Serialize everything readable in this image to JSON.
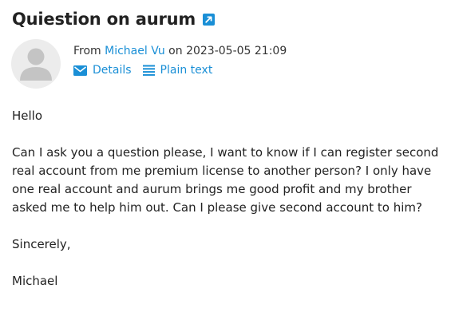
{
  "email": {
    "subject": "Quiestion on aurum",
    "from_prefix": "From",
    "sender_name": "Michael Vu",
    "on_word": "on",
    "timestamp": "2023-05-05 21:09",
    "actions": {
      "details_label": "Details",
      "plain_text_label": "Plain text"
    },
    "body": {
      "greeting": "Hello",
      "paragraph": "Can I ask you a question please, I want to know if I can register second real account from me premium license to another person? I only have one real account and aurum brings me good profit and my brother asked me to help him out. Can I please give second account to him?",
      "closing": "Sincerely,",
      "signature": "Michael"
    }
  },
  "colors": {
    "accent": "#1a8fd6",
    "title": "#222222",
    "avatar_bg": "#ececec",
    "avatar_fg": "#c4c4c4"
  },
  "icons": [
    "external-link-icon",
    "avatar-person-icon",
    "envelope-icon",
    "list-lines-icon"
  ]
}
